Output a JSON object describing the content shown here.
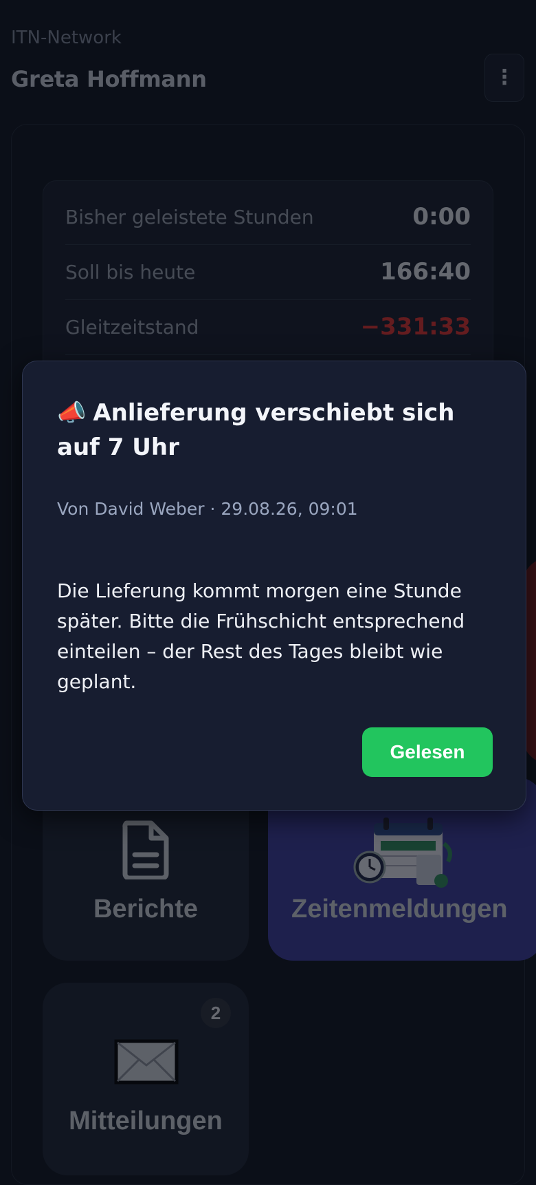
{
  "header": {
    "org": "ITN-Network",
    "user": "Greta Hoffmann"
  },
  "stats": [
    {
      "label": "Bisher geleistete Stunden",
      "value": "0:00"
    },
    {
      "label": "Soll bis heute",
      "value": "166:40"
    },
    {
      "label": "Gleitzeitstand",
      "value": "−331:33"
    }
  ],
  "tiles": {
    "reports": "Berichte",
    "time_reports": "Zeitenmeldungen",
    "messages": "Mitteilungen",
    "messages_badge": "2"
  },
  "modal": {
    "icon": "📣",
    "title": "Anlieferung verschiebt sich auf 7 Uhr",
    "meta": "Von David Weber · 29.08.26, 09:01",
    "body": "Die Lieferung kommt morgen eine Stunde später. Bitte die Frühschicht entsprechend einteilen – der Rest des Tages bleibt wie geplant.",
    "button": "Gelesen"
  },
  "colors": {
    "background": "#0b0f18",
    "negative": "#e0302b",
    "accent_tile": "#3a3a9a",
    "confirm": "#22c55e"
  }
}
